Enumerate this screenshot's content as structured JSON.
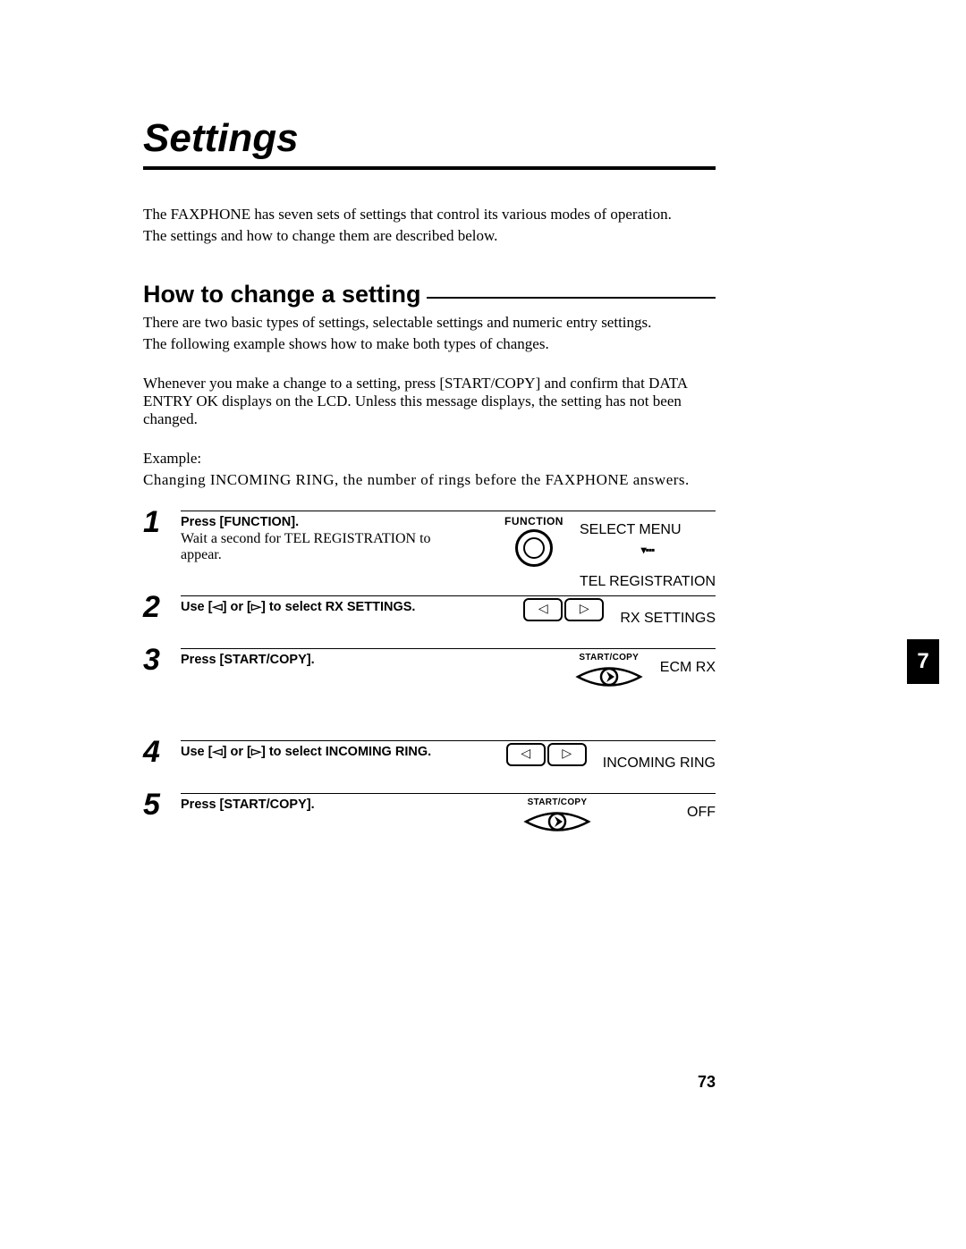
{
  "chapter": {
    "title": "Settings",
    "tab_number": "7"
  },
  "intro": {
    "line1": "The FAXPHONE has seven sets of settings that control its various modes of operation.",
    "line2": "The settings and how to change them are described below."
  },
  "section": {
    "title": "How to change a setting",
    "p1": "There are two basic types of settings, selectable settings and numeric entry settings.",
    "p2": "The following example shows how to make both types of changes.",
    "p3": "Whenever you make a change to a setting, press [START/COPY] and confirm that DATA ENTRY OK displays on the LCD. Unless this message displays, the setting has not been changed.",
    "example_label": "Example:",
    "example_text": "Changing INCOMING RING, the number of rings before the FAXPHONE answers."
  },
  "steps": [
    {
      "num": "1",
      "instr": "Press [FUNCTION].",
      "sub": "Wait a second for TEL REGISTRATION to appear.",
      "button_label": "FUNCTION",
      "lcd1": "SELECT MENU",
      "lcd2": "TEL REGISTRATION"
    },
    {
      "num": "2",
      "instr_prefix": "Use [",
      "instr_mid": "] or [",
      "instr_suffix": "] to select RX SETTINGS.",
      "lcd1": "RX SETTINGS"
    },
    {
      "num": "3",
      "instr": "Press [START/COPY].",
      "button_label": "START/COPY",
      "lcd1": "ECM RX"
    },
    {
      "num": "4",
      "instr_prefix": "Use [",
      "instr_mid": "] or [",
      "instr_suffix": "] to select INCOMING RING.",
      "lcd1": "INCOMING RING"
    },
    {
      "num": "5",
      "instr": "Press [START/COPY].",
      "button_label": "START/COPY",
      "lcd1": "OFF"
    }
  ],
  "page_number": "73"
}
